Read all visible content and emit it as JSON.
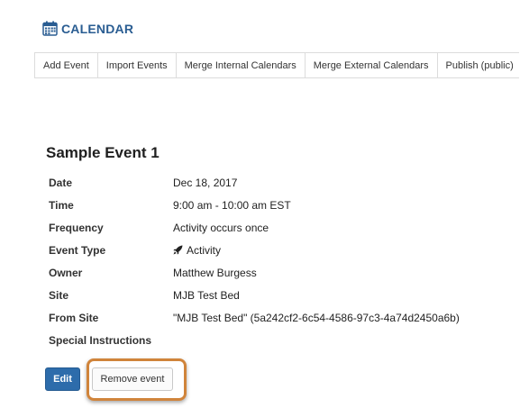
{
  "header": {
    "title": "CALENDAR",
    "icon": "calendar-icon"
  },
  "toolbar": {
    "items": [
      "Add Event",
      "Import Events",
      "Merge Internal Calendars",
      "Merge External Calendars",
      "Publish (public)"
    ]
  },
  "event": {
    "title": "Sample Event 1",
    "fields": [
      {
        "label": "Date",
        "value": "Dec 18, 2017"
      },
      {
        "label": "Time",
        "value": "9:00 am - 10:00 am EST"
      },
      {
        "label": "Frequency",
        "value": "Activity occurs once"
      },
      {
        "label": "Event Type",
        "value": "Activity",
        "icon": "rocket-icon"
      },
      {
        "label": "Owner",
        "value": "Matthew Burgess"
      },
      {
        "label": "Site",
        "value": "MJB Test Bed"
      },
      {
        "label": "From Site",
        "value": "\"MJB Test Bed\" (5a242cf2-6c54-4586-97c3-4a74d2450a6b)"
      },
      {
        "label": "Special Instructions",
        "value": ""
      }
    ]
  },
  "actions": {
    "edit_label": "Edit",
    "remove_label": "Remove event"
  },
  "colors": {
    "accent": "#2a5d92",
    "button_primary": "#2d6cab",
    "highlight": "#d0843b"
  }
}
